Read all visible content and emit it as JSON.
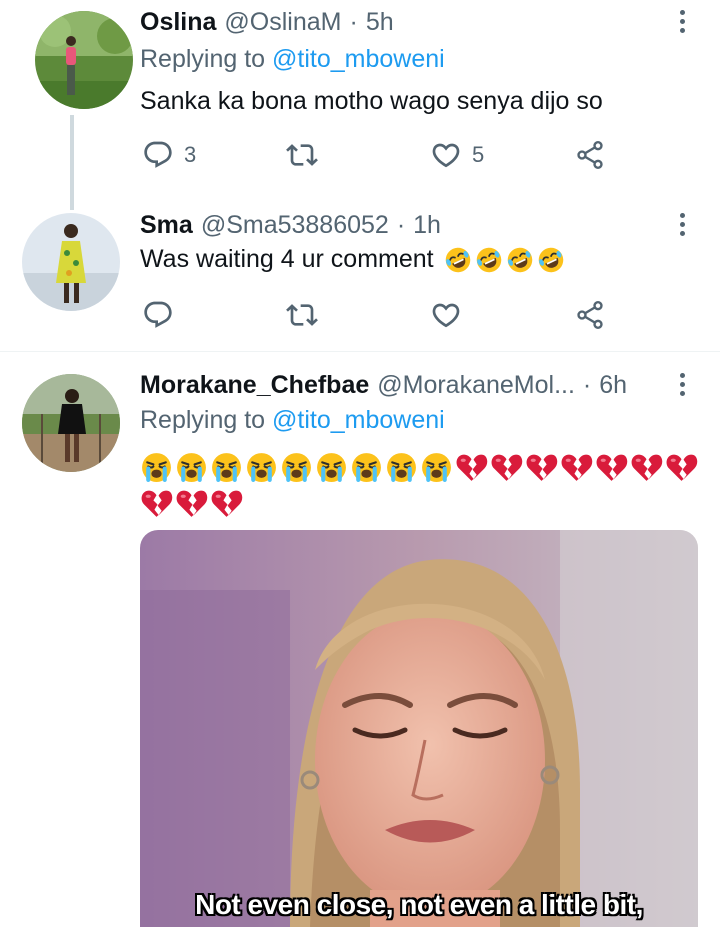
{
  "tweets": [
    {
      "name": "Oslina",
      "handle": "@OslinaM",
      "separator": "·",
      "time": "5h",
      "replying_prefix": "Replying to",
      "replying_to": "@tito_mboweni",
      "text": "Sanka ka bona motho wago senya dijo so",
      "replies": "3",
      "retweets": "",
      "likes": "5"
    },
    {
      "name": "Sma",
      "handle": "@Sma53886052",
      "separator": "·",
      "time": "1h",
      "text": "Was waiting 4 ur comment",
      "emojis": [
        "🤣",
        "🤣",
        "🤣",
        "🤣"
      ],
      "replies": "",
      "retweets": "",
      "likes": ""
    },
    {
      "name": "Morakane_Chefbae",
      "handle": "@MorakaneMol...",
      "separator": "·",
      "time": "6h",
      "replying_prefix": "Replying to",
      "replying_to": "@tito_mboweni",
      "emojis_line1": [
        "😭",
        "😭",
        "😭",
        "😭",
        "😭",
        "😭",
        "😭",
        "😭",
        "😭",
        "💔",
        "💔",
        "💔",
        "💔",
        "💔",
        "💔",
        "💔"
      ],
      "emojis_line2": [
        "💔",
        "💔",
        "💔"
      ],
      "media_caption": "Not even close, not even a little bit,"
    }
  ],
  "icons": {
    "reply": "reply-icon",
    "retweet": "retweet-icon",
    "like": "heart-icon",
    "share": "share-icon",
    "more": "more-icon"
  },
  "colors": {
    "accent": "#1d9bf0",
    "secondary_text": "#536471",
    "primary_text": "#0f1419",
    "thread_line": "#cfd9de",
    "crying": "#fcc21b",
    "broken_heart": "#d91b3b"
  }
}
